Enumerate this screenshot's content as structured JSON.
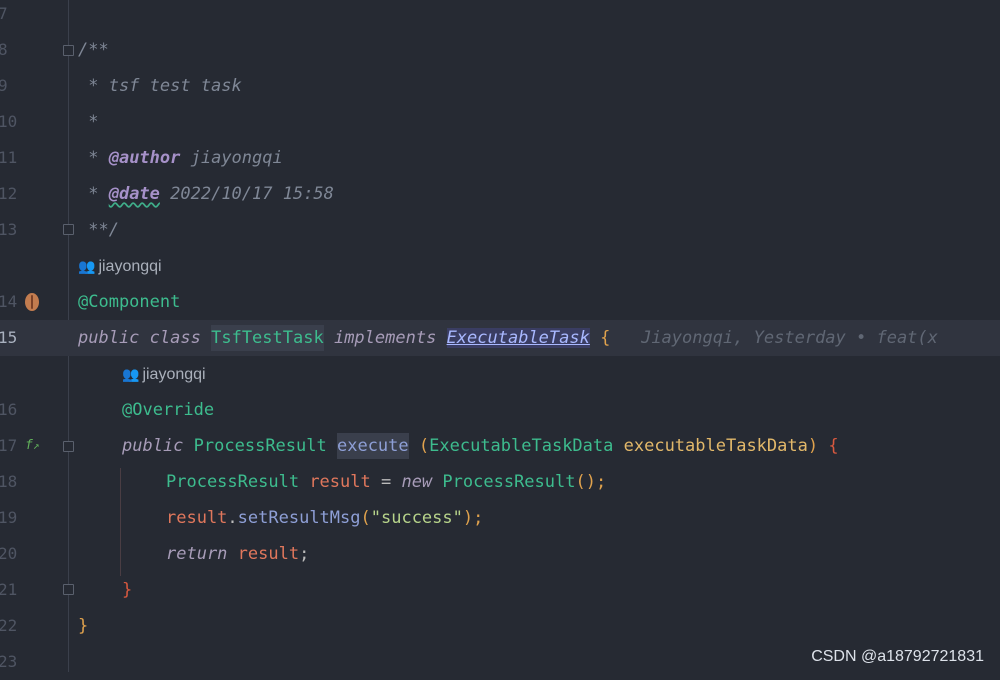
{
  "line_numbers": {
    "l7": "7",
    "l8": "8",
    "l9": "9",
    "l10": "10",
    "l11": "11",
    "l12": "12",
    "l13": "13",
    "l14": "14",
    "l15": "15",
    "l16": "16",
    "l17": "17",
    "l18": "18",
    "l19": "19",
    "l20": "20",
    "l21": "21",
    "l22": "22",
    "l23": "23"
  },
  "doc": {
    "open": "/**",
    "desc": " * tsf test task",
    "star": " *",
    "author_prefix": " * ",
    "author_tag": "@author",
    "author_value": " jiayongqi",
    "date_prefix": " * ",
    "date_tag": "@date",
    "date_value": " 2022/10/17 15:58",
    "close": " **/"
  },
  "inlays": {
    "class_author": "jiayongqi",
    "method_author": "jiayongqi"
  },
  "code": {
    "annotation_component": "@Component",
    "kw_public": "public",
    "kw_class": "class",
    "class_name": "TsfTestTask",
    "kw_implements": "implements",
    "interface_name": "ExecutableTask",
    "open_brace": "{",
    "blame": "Jiayongqi, Yesterday • feat(x",
    "annotation_override": "@Override",
    "return_type": "ProcessResult",
    "method_name": "execute",
    "paren_open": "(",
    "param_type": "ExecutableTaskData",
    "param_name": "executableTaskData",
    "paren_close": ")",
    "method_brace": "{",
    "l18_type": "ProcessResult",
    "l18_var": "result",
    "l18_eq": " = ",
    "l18_new": "new",
    "l18_ctor": "ProcessResult",
    "l18_end": "();",
    "l19_var": "result",
    "l19_dot": ".",
    "l19_method": "setResultMsg",
    "l19_open": "(",
    "l19_str": "\"success\"",
    "l19_close": ");",
    "l20_return": "return",
    "l20_var": "result",
    "l20_end": ";",
    "method_close": "}",
    "class_close": "}"
  },
  "icons": {
    "bean": "spring-bean-icon",
    "fx": "implements-method-icon",
    "fold": "fold-marker-icon",
    "people": "author-people-icon"
  },
  "fx_label": "f",
  "watermark": "CSDN @a18792721831"
}
